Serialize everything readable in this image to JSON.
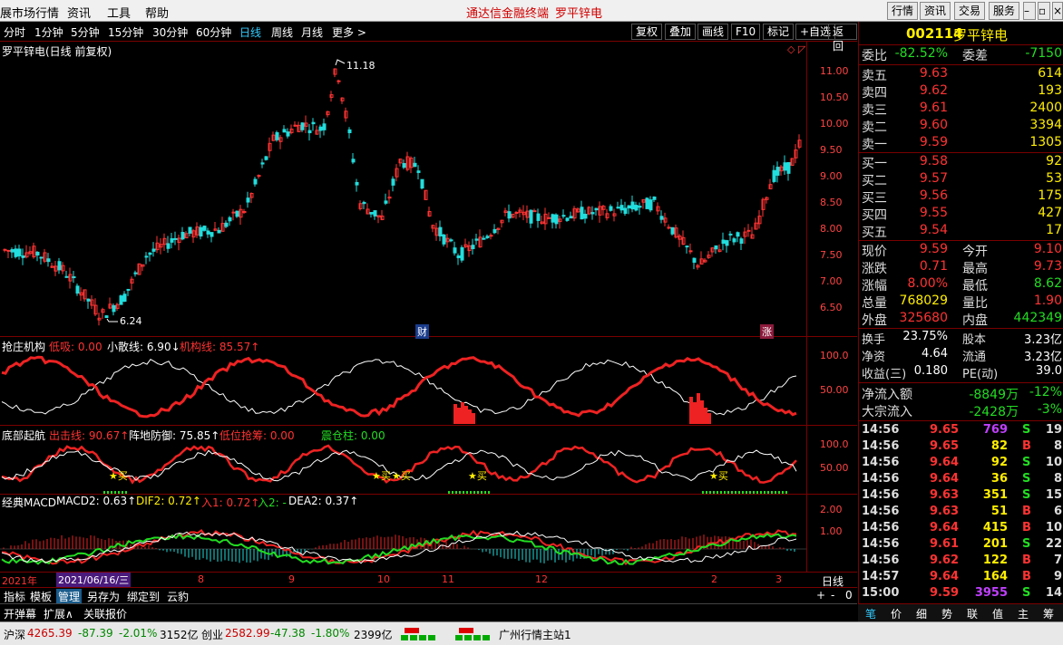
{
  "menu": {
    "items": [
      "展市场行情",
      "资讯",
      "工具",
      "帮助"
    ],
    "center": [
      "通达信金融终端",
      "罗平锌电"
    ],
    "buttons": [
      "行情",
      "资讯",
      "交易",
      "服务"
    ]
  },
  "periods": [
    "分时",
    "1分钟",
    "5分钟",
    "15分钟",
    "30分钟",
    "60分钟",
    "日线",
    "周线",
    "月线",
    "更多 >"
  ],
  "tools": [
    "复权",
    "叠加",
    "画线",
    "F10",
    "标记",
    "+自选",
    "返回"
  ],
  "main": {
    "title": "罗平锌电(日线 前复权)",
    "high_label": "11.18",
    "low_label": "6.24",
    "marker_cai": "财",
    "marker_zhang": "涨",
    "yticks": [
      "11.00",
      "10.50",
      "10.00",
      "9.50",
      "9.00",
      "8.50",
      "8.00",
      "7.50",
      "7.00",
      "6.50"
    ]
  },
  "ind1": {
    "name": "抢庄机构",
    "a": "低吸: 0.00",
    "b": "小散线: 6.90↓",
    "c": "机构线: 85.57↑",
    "yticks": [
      "100.0",
      "50.00"
    ]
  },
  "ind2": {
    "name": "底部起航",
    "a": "出击线: 90.67↑",
    "b": "阵地防御: 75.85↑",
    "c": "低位抢筹: 0.00",
    "d": "震仓柱: 0.00",
    "buy_label": "★买",
    "yticks": [
      "100.0",
      "50.00"
    ]
  },
  "macd": {
    "name": "经典MACD",
    "a": "MACD2: 0.63↑",
    "b": "DIF2: 0.72↑",
    "c": "入1: 0.72↑",
    "d": "入2: -",
    "e": "DEA2: 0.37↑",
    "yticks": [
      "2.00",
      "1.00"
    ]
  },
  "xaxis": {
    "year": "2021年",
    "date": "2021/06/16/三",
    "months": [
      "8",
      "9",
      "10",
      "11",
      "12",
      "2",
      "3"
    ],
    "period": "日线"
  },
  "bottom_tabs": [
    "指标",
    "模板",
    "管理",
    "另存为",
    "绑定到",
    "云豹"
  ],
  "bottom_tabs2": [
    "开弹幕",
    "扩展∧",
    "关联报价"
  ],
  "bottom_ctrl": [
    "+",
    "-",
    "0"
  ],
  "quote": {
    "code": "002114",
    "name": "罗平锌电",
    "weibi_label": "委比",
    "weibi": "-82.52%",
    "weicha_label": "委差",
    "weicha": "-7150",
    "asks": [
      {
        "label": "卖五",
        "price": "9.63",
        "vol": "614"
      },
      {
        "label": "卖四",
        "price": "9.62",
        "vol": "193"
      },
      {
        "label": "卖三",
        "price": "9.61",
        "vol": "2400"
      },
      {
        "label": "卖二",
        "price": "9.60",
        "vol": "3394"
      },
      {
        "label": "卖一",
        "price": "9.59",
        "vol": "1305"
      }
    ],
    "bids": [
      {
        "label": "买一",
        "price": "9.58",
        "vol": "92"
      },
      {
        "label": "买二",
        "price": "9.57",
        "vol": "53"
      },
      {
        "label": "买三",
        "price": "9.56",
        "vol": "175"
      },
      {
        "label": "买四",
        "price": "9.55",
        "vol": "427"
      },
      {
        "label": "买五",
        "price": "9.54",
        "vol": "17"
      }
    ],
    "stats": [
      {
        "l1": "现价",
        "v1": "9.59",
        "l2": "今开",
        "v2": "9.10",
        "c1": "red",
        "c2": "red"
      },
      {
        "l1": "涨跌",
        "v1": "0.71",
        "l2": "最高",
        "v2": "9.73",
        "c1": "red",
        "c2": "red"
      },
      {
        "l1": "涨幅",
        "v1": "8.00%",
        "l2": "最低",
        "v2": "8.62",
        "c1": "red",
        "c2": "green"
      },
      {
        "l1": "总量",
        "v1": "768029",
        "l2": "量比",
        "v2": "1.90",
        "c1": "yellow",
        "c2": "red"
      },
      {
        "l1": "外盘",
        "v1": "325680",
        "l2": "内盘",
        "v2": "442349",
        "c1": "red",
        "c2": "green"
      }
    ],
    "stats2": [
      {
        "l1": "换手",
        "v1": "23.75%",
        "l2": "股本",
        "v2": "3.23亿"
      },
      {
        "l1": "净资",
        "v1": "4.64",
        "l2": "流通",
        "v2": "3.23亿"
      },
      {
        "l1": "收益(三)",
        "v1": "0.180",
        "l2": "PE(动)",
        "v2": "39.0"
      }
    ],
    "flow": [
      {
        "label": "净流入额",
        "v1": "-8849万",
        "v2": "-12%"
      },
      {
        "label": "大宗流入",
        "v1": "-2428万",
        "v2": "-3%"
      }
    ],
    "ticks": [
      {
        "t": "14:56",
        "p": "9.65",
        "v": "769",
        "s": "S",
        "n": "19"
      },
      {
        "t": "14:56",
        "p": "9.65",
        "v": "82",
        "s": "B",
        "n": "8"
      },
      {
        "t": "14:56",
        "p": "9.64",
        "v": "92",
        "s": "S",
        "n": "10"
      },
      {
        "t": "14:56",
        "p": "9.64",
        "v": "36",
        "s": "S",
        "n": "8"
      },
      {
        "t": "14:56",
        "p": "9.63",
        "v": "351",
        "s": "S",
        "n": "15"
      },
      {
        "t": "14:56",
        "p": "9.63",
        "v": "51",
        "s": "B",
        "n": "6"
      },
      {
        "t": "14:56",
        "p": "9.64",
        "v": "415",
        "s": "B",
        "n": "10"
      },
      {
        "t": "14:56",
        "p": "9.61",
        "v": "201",
        "s": "S",
        "n": "22"
      },
      {
        "t": "14:56",
        "p": "9.62",
        "v": "122",
        "s": "B",
        "n": "7"
      },
      {
        "t": "14:57",
        "p": "9.64",
        "v": "164",
        "s": "B",
        "n": "9"
      },
      {
        "t": "15:00",
        "p": "9.59",
        "v": "3955",
        "s": "S",
        "n": "14"
      }
    ],
    "tabs": [
      "笔",
      "价",
      "细",
      "势",
      "联",
      "值",
      "主",
      "筹"
    ]
  },
  "status": {
    "sh_label": "沪深",
    "sh_val": "4265.39",
    "sh_chg": "-87.39",
    "sh_pct": "-2.01%",
    "sh_amt": "3152亿",
    "cy_label": "创业",
    "cy_val": "2582.99",
    "cy_chg": "-47.38",
    "cy_pct": "-1.80%",
    "cy_amt": "2399亿",
    "server": "广州行情主站1"
  },
  "colors": {
    "up": "#ff3333",
    "down": "#22dddd",
    "bg": "#000000",
    "grid": "#7a0000"
  }
}
